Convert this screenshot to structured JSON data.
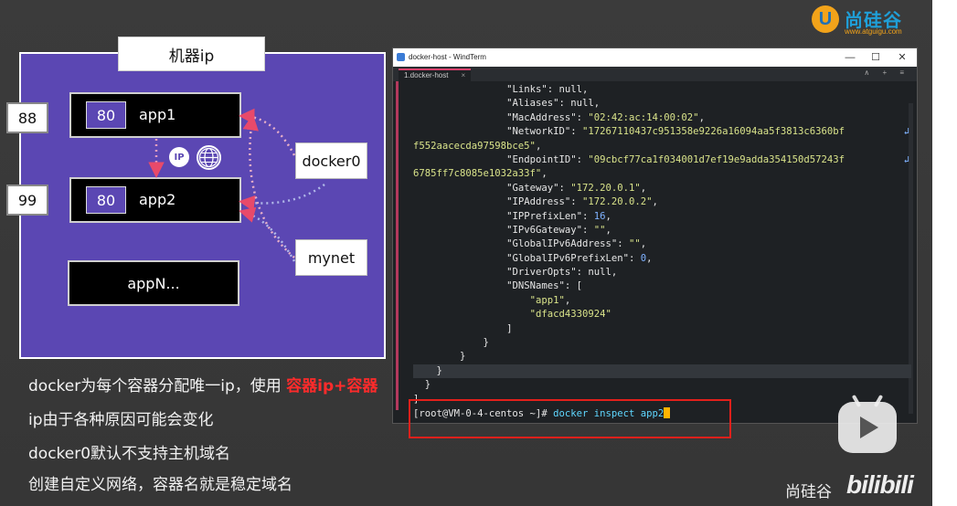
{
  "logo": {
    "mark": "U",
    "name": "尚硅谷",
    "url": "www.atguigu.com"
  },
  "diagram": {
    "title": "机器ip",
    "host_ports": [
      "88",
      "99"
    ],
    "apps": [
      {
        "port": "80",
        "label": "app1"
      },
      {
        "port": "80",
        "label": "app2"
      }
    ],
    "appN": "appN...",
    "networks": [
      "docker0",
      "mynet"
    ],
    "ip_badge": "IP"
  },
  "bullets": [
    {
      "text": "docker为每个容器分配唯一ip，使用 ",
      "highlight": "容器ip+容器"
    },
    {
      "text": "ip由于各种原因可能会变化"
    },
    {
      "text": "docker0默认不支持主机域名"
    },
    {
      "text": "创建自定义网络，容器名就是稳定域名"
    }
  ],
  "terminal": {
    "window_title": "docker-host - WindTerm",
    "tab_label": "1.docker-host",
    "window_controls": [
      "—",
      "☐",
      "✕"
    ],
    "tab_tools": "∧ + ≡",
    "lines": [
      {
        "indent": "                ",
        "key": "\"Links\"",
        "sep": ": ",
        "val": "null",
        "vt": "k",
        "end": ","
      },
      {
        "indent": "                ",
        "key": "\"Aliases\"",
        "sep": ": ",
        "val": "null",
        "vt": "k",
        "end": ","
      },
      {
        "indent": "                ",
        "key": "\"MacAddress\"",
        "sep": ": ",
        "val": "\"02:42:ac:14:00:02\"",
        "vt": "s",
        "end": ","
      },
      {
        "indent": "                ",
        "key": "\"NetworkID\"",
        "sep": ": ",
        "val": "\"17267110437c951358e9226a16094aa5f3813c6360bf",
        "vt": "s",
        "end": "",
        "wrap": "↲"
      },
      {
        "indent": "",
        "key": "",
        "sep": "",
        "val": "f552aacecda97598bce5\"",
        "vt": "s",
        "end": ","
      },
      {
        "indent": "                ",
        "key": "\"EndpointID\"",
        "sep": ": ",
        "val": "\"09cbcf77ca1f034001d7ef19e9adda354150d57243f",
        "vt": "s",
        "end": "",
        "wrap": "↲"
      },
      {
        "indent": "",
        "key": "",
        "sep": "",
        "val": "6785ff7c8085e1032a33f\"",
        "vt": "s",
        "end": ","
      },
      {
        "indent": "                ",
        "key": "\"Gateway\"",
        "sep": ": ",
        "val": "\"172.20.0.1\"",
        "vt": "s",
        "end": ","
      },
      {
        "indent": "                ",
        "key": "\"IPAddress\"",
        "sep": ": ",
        "val": "\"172.20.0.2\"",
        "vt": "s",
        "end": ","
      },
      {
        "indent": "                ",
        "key": "\"IPPrefixLen\"",
        "sep": ": ",
        "val": "16",
        "vt": "n",
        "end": ","
      },
      {
        "indent": "                ",
        "key": "\"IPv6Gateway\"",
        "sep": ": ",
        "val": "\"\"",
        "vt": "s",
        "end": ","
      },
      {
        "indent": "                ",
        "key": "\"GlobalIPv6Address\"",
        "sep": ": ",
        "val": "\"\"",
        "vt": "s",
        "end": ","
      },
      {
        "indent": "                ",
        "key": "\"GlobalIPv6PrefixLen\"",
        "sep": ": ",
        "val": "0",
        "vt": "n",
        "end": ","
      },
      {
        "indent": "                ",
        "key": "\"DriverOpts\"",
        "sep": ": ",
        "val": "null",
        "vt": "k",
        "end": ","
      },
      {
        "indent": "                ",
        "key": "\"DNSNames\"",
        "sep": ": ",
        "val": "[",
        "vt": "k",
        "end": ""
      },
      {
        "indent": "                    ",
        "key": "",
        "sep": "",
        "val": "\"app1\"",
        "vt": "s",
        "end": ","
      },
      {
        "indent": "                    ",
        "key": "",
        "sep": "",
        "val": "\"dfacd4330924\"",
        "vt": "s",
        "end": ""
      },
      {
        "indent": "                ",
        "key": "",
        "sep": "",
        "val": "]",
        "vt": "k",
        "end": ""
      },
      {
        "indent": "            ",
        "key": "",
        "sep": "",
        "val": "}",
        "vt": "k",
        "end": ""
      },
      {
        "indent": "        ",
        "key": "",
        "sep": "",
        "val": "}",
        "vt": "k",
        "end": ""
      },
      {
        "indent": "    ",
        "key": "",
        "sep": "",
        "val": "}",
        "vt": "k",
        "end": "",
        "hl": true
      },
      {
        "indent": "  ",
        "key": "",
        "sep": "",
        "val": "}",
        "vt": "k",
        "end": ""
      },
      {
        "indent": "",
        "key": "",
        "sep": "",
        "val": "]",
        "vt": "k",
        "end": ""
      }
    ],
    "prompt": "[root@VM-0-4-centos ~]#",
    "command": "docker inspect app2"
  },
  "footer": {
    "brand": "尚硅谷",
    "bili": "bilibili"
  },
  "colors": {
    "panel": "#5b47b3",
    "highlight_red": "#ff2b2b",
    "frame_red": "#e3201b",
    "tab_accent": "#d8406c"
  }
}
